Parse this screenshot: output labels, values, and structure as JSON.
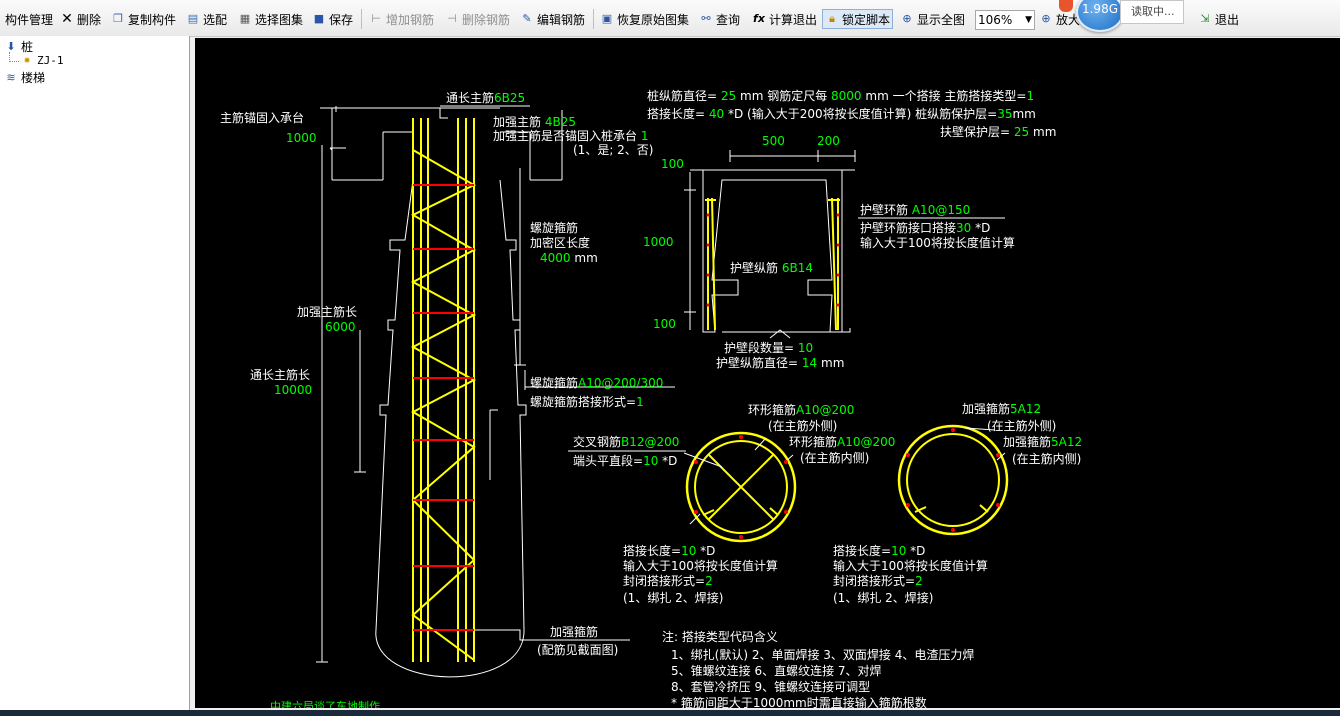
{
  "toolbar": {
    "items": [
      {
        "label": "构件管理"
      },
      {
        "label": "删除"
      },
      {
        "label": "复制构件"
      },
      {
        "label": "选配"
      },
      {
        "label": "选择图集"
      },
      {
        "label": "保存"
      },
      {
        "label": "增加钢筋"
      },
      {
        "label": "删除钢筋"
      },
      {
        "label": "编辑钢筋"
      },
      {
        "label": "恢复原始图集"
      },
      {
        "label": "查询"
      },
      {
        "label": "计算退出"
      },
      {
        "label": "锁定脚本"
      },
      {
        "label": "显示全图"
      },
      {
        "label": "放大"
      },
      {
        "label": "退出"
      }
    ],
    "zoom_value": "106%",
    "speed_badge": "1.98G",
    "loading_text": "读取中..."
  },
  "tree": {
    "root": "桩",
    "child": "ZJ-1",
    "sibling": "楼梯"
  },
  "drawing": {
    "params": {
      "line1a": "桩纵筋直径=",
      "pile_dia": "25",
      "line1b": "mm  钢筋定尺每",
      "rebar_len": "8000",
      "line1c": "mm 一个搭接   主筋搭接类型=",
      "splice_type": "1",
      "line2a": "搭接长度=",
      "lap_len": "40",
      "line2b": "*D (输入大于200将按长度值计算) 桩纵筋保护层=",
      "cover": "35",
      "line2c": "mm",
      "line3a": "扶壁保护层=",
      "wall_cover": "25",
      "line3b": "mm"
    },
    "left": {
      "anchor_label": "主筋锚固入承台",
      "anchor_val": "1000",
      "through_main_label": "通长主筋",
      "through_main_val": "6B25",
      "reinf_main_label": "加强主筋",
      "reinf_main_val": "4B25",
      "reinf_anchor_label": "加强主筋是否锚固入桩承台",
      "reinf_anchor_val": "1",
      "reinf_anchor_opts": "(1、是; 2、否)",
      "spiral_dense_1": "螺旋箍筋",
      "spiral_dense_2": "加密区长度",
      "spiral_dense_val": "4000",
      "spiral_dense_unit": "mm",
      "reinf_len_label": "加强主筋长",
      "reinf_len_val": "6000",
      "through_len_label": "通长主筋长",
      "through_len_val": "10000",
      "spiral_label": "螺旋箍筋",
      "spiral_val": "A10@200/300",
      "spiral_lap_label": "螺旋箍筋搭接形式=",
      "spiral_lap_val": "1",
      "reinf_stirrup_label": "加强箍筋",
      "reinf_stirrup_note": "(配筋见截面图)",
      "bottom_text": "中建六局谈了东地制作"
    },
    "wall": {
      "dim_top1": "500",
      "dim_top2": "200",
      "dim_left_top": "100",
      "dim_left_mid": "1000",
      "dim_left_bot": "100",
      "hoop_label": "护壁环筋",
      "hoop_val": "A10@150",
      "hoop_joint_label": "护壁环筋接口搭接",
      "hoop_joint_val": "30",
      "hoop_joint_unit": "*D",
      "hoop_joint_note": "输入大于100将按长度值计算",
      "long_label": "护壁纵筋",
      "long_val": "6B14",
      "seg_label": "护壁段数量=",
      "seg_val": "10",
      "long_dia_label": "护壁纵筋直径=",
      "long_dia_val": "14",
      "long_dia_unit": "mm"
    },
    "circle1": {
      "outer_label": "环形箍筋",
      "outer_val": "A10@200",
      "outer_note": "(在主筋外侧)",
      "inner_label": "环形箍筋",
      "inner_val": "A10@200",
      "inner_note": "(在主筋内侧)",
      "cross_label": "交叉钢筋",
      "cross_val": "B12@200",
      "end_label": "端头平直段=",
      "end_val": "10",
      "end_unit": "*D",
      "lap_label": "搭接长度=",
      "lap_val": "10",
      "lap_unit": "*D",
      "lap_note": "输入大于100将按长度值计算",
      "close_label": "封闭搭接形式=",
      "close_val": "2",
      "close_opts": "(1、绑扎  2、焊接)"
    },
    "circle2": {
      "outer_label": "加强箍筋",
      "outer_val": "5A12",
      "outer_note": "(在主筋外侧)",
      "inner_label": "加强箍筋",
      "inner_val": "5A12",
      "inner_note": "(在主筋内侧)",
      "lap_label": "搭接长度=",
      "lap_val": "10",
      "lap_unit": "*D",
      "lap_note": "输入大于100将按长度值计算",
      "close_label": "封闭搭接形式=",
      "close_val": "2",
      "close_opts": "(1、绑扎  2、焊接)"
    },
    "note": {
      "title": "注: 搭接类型代码含义",
      "line1": "1、绑扎(默认)    2、单面焊接    3、双面焊接    4、电渣压力焊",
      "line2": "5、锥螺纹连接    6、直螺纹连接    7、对焊",
      "line3": "8、套管冷挤压    9、锥螺纹连接可调型",
      "line4": "* 箍筋间距大于1000mm时需直接输入箍筋根数"
    }
  },
  "colors": {
    "canvas_bg": "#000000",
    "cad_white": "#ffffff",
    "cad_green": "#00ff00",
    "rebar_yellow": "#ffff00",
    "rebar_red": "#ff0000"
  }
}
